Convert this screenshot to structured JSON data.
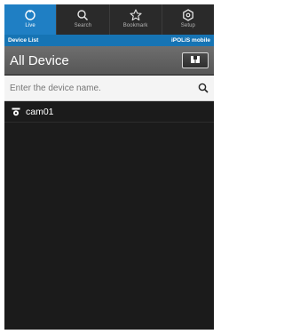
{
  "tabs": [
    {
      "label": "Live",
      "icon": "live-icon",
      "active": true
    },
    {
      "label": "Search",
      "icon": "search-icon",
      "active": false
    },
    {
      "label": "Bookmark",
      "icon": "star-icon",
      "active": false
    },
    {
      "label": "Setup",
      "icon": "gear-icon",
      "active": false
    }
  ],
  "subbar": {
    "left": "Device List",
    "right": "iPOLiS mobile"
  },
  "header": {
    "title": "All Device",
    "button_icon": "book-icon"
  },
  "search": {
    "placeholder": "Enter the device name.",
    "value": ""
  },
  "devices": [
    {
      "name": "cam01",
      "icon": "camera-icon"
    }
  ],
  "colors": {
    "accent": "#1f7fc4",
    "subbar": "#1674b4",
    "background": "#1b1b1b"
  }
}
